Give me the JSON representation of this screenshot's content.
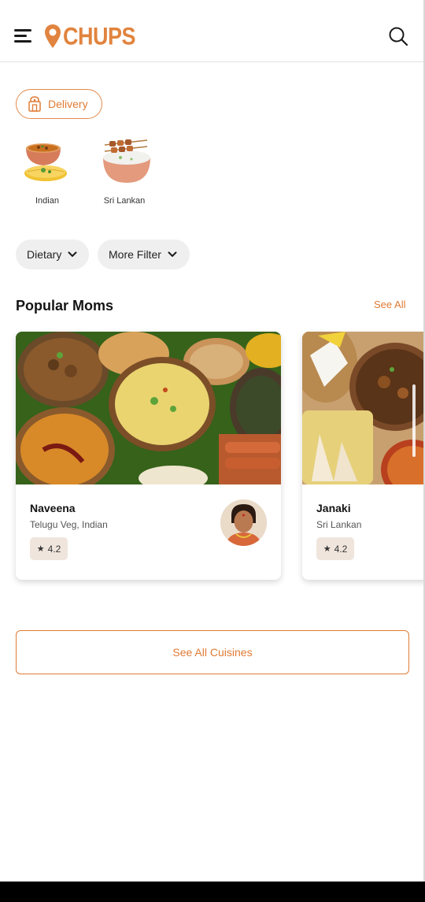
{
  "header": {
    "logo_text": "CHUPS",
    "brand_color": "#e07b35",
    "menu_icon": "hamburger-menu-icon",
    "search_icon": "search-icon"
  },
  "delivery": {
    "label": "Delivery",
    "icon": "delivery-bag-icon"
  },
  "cuisines": [
    {
      "label": "Indian",
      "icon": "indian-food-icon"
    },
    {
      "label": "Sri Lankan",
      "icon": "sri-lankan-food-icon"
    }
  ],
  "filters": [
    {
      "label": "Dietary",
      "icon": "chevron-down-icon"
    },
    {
      "label": "More Filter",
      "icon": "chevron-down-icon"
    }
  ],
  "popular": {
    "title": "Popular Moms",
    "see_all": "See All",
    "cards": [
      {
        "name": "Naveena",
        "cuisine": "Telugu Veg, Indian",
        "rating": "4.2",
        "star": "★"
      },
      {
        "name": "Janaki",
        "cuisine": "Sri Lankan",
        "rating": "4.2",
        "star": "★"
      }
    ]
  },
  "see_all_cuisines": "See All Cuisines"
}
